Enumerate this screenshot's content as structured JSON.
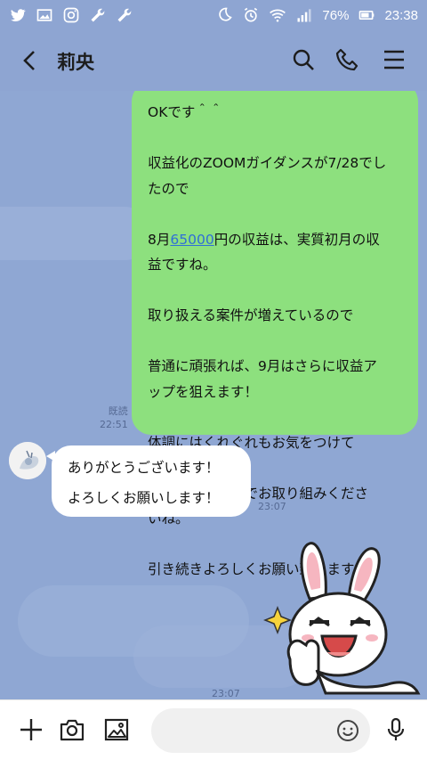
{
  "status_bar": {
    "battery": "76%",
    "time": "23:38",
    "icons_left": [
      "twitter-icon",
      "image-icon",
      "instagram-icon",
      "wrench-icon",
      "wrench-icon"
    ],
    "icons_right": [
      "moon-icon",
      "alarm-icon",
      "wifi-icon",
      "signal-icon",
      "battery-icon"
    ]
  },
  "header": {
    "title": "莉央",
    "buttons": [
      "back-icon",
      "search-icon",
      "phone-icon",
      "menu-icon"
    ]
  },
  "messages": {
    "outgoing": {
      "lines": [
        "OKです＾＾",
        "",
        "収益化のZOOMガイダンスが7/28でし",
        "たので",
        "",
        "8月",
        "",
        "益ですね。",
        "",
        "取り扱える案件が増えているので",
        "",
        "普通に頑張れば、9月はさらに収益ア",
        "ップを狙えます！",
        "",
        "体調にはくれぐれもお気をつけて",
        "",
        "無理のない範囲でお取り組みくださ",
        "いね。",
        "",
        "引き続きよろしくお願い致します！"
      ],
      "line6_prefix": "8月",
      "line6_link": "65000",
      "line6_suffix": "円の収益は、実質初月の収",
      "read_label": "既読",
      "time": "22:51"
    },
    "incoming": {
      "line1": "ありがとうございます！",
      "line2": "よろしくお願いします！",
      "time": "23:07"
    },
    "sticker_time": "23:07"
  },
  "composer": {
    "placeholder": "",
    "buttons": [
      "plus-icon",
      "camera-icon",
      "gallery-icon",
      "emoji-icon",
      "mic-icon"
    ]
  },
  "colors": {
    "background": "#8fa7d3",
    "outgoing_bubble": "#8de07e",
    "incoming_bubble": "#ffffff",
    "link": "#2f6fd6"
  }
}
